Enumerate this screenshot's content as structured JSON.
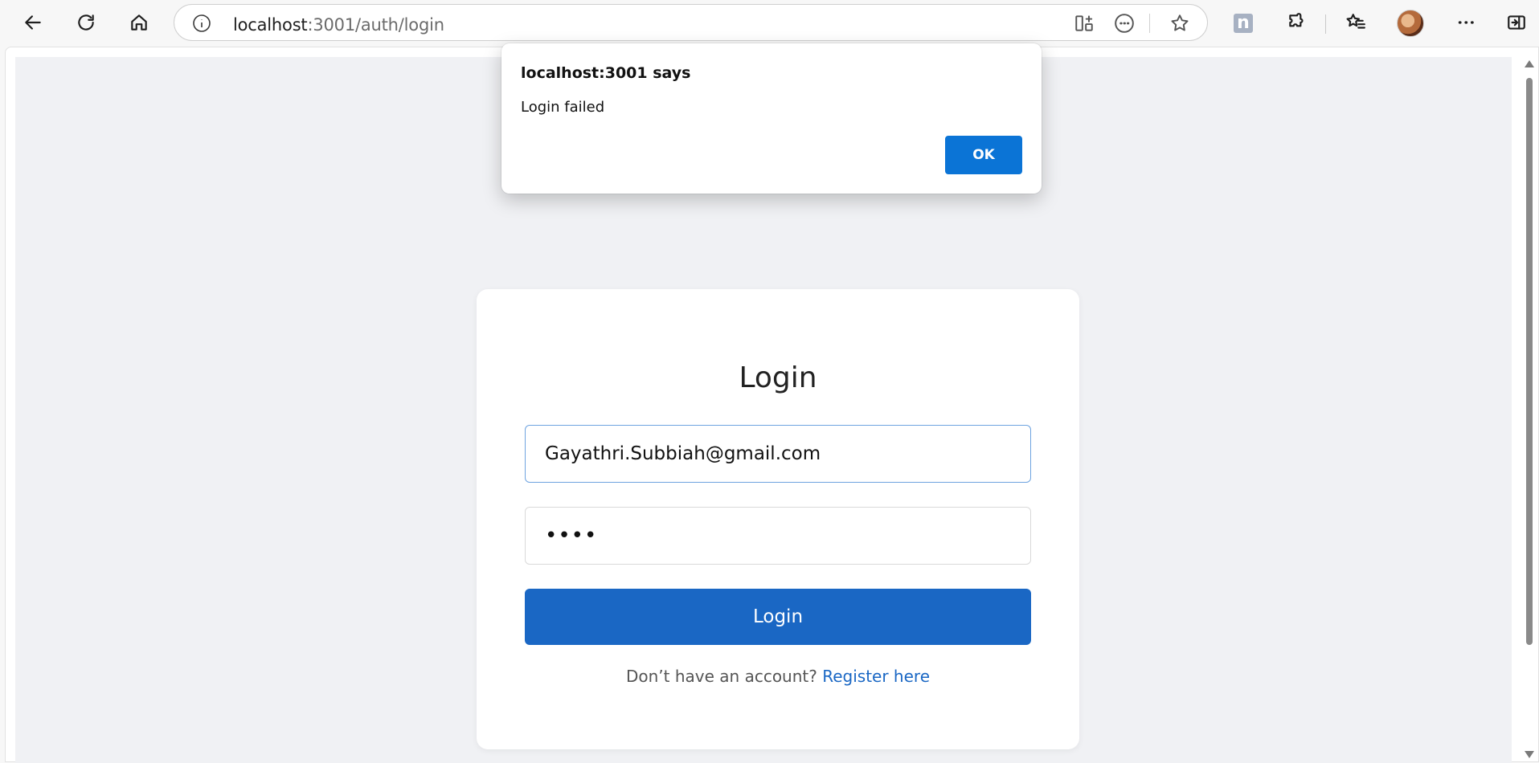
{
  "browser": {
    "url_host": "localhost",
    "url_path": ":3001/auth/login",
    "extension_label": "n",
    "icons": {
      "back": "back-arrow-icon",
      "reload": "reload-icon",
      "home": "home-icon",
      "site_info": "info-icon",
      "split_screen": "split-screen-icon",
      "more_page": "ellipsis-circle-icon",
      "favorite": "star-icon",
      "extensions": "puzzle-icon",
      "favorites": "favorites-list-icon",
      "menu": "more-icon",
      "sidebar": "sidebar-icon"
    }
  },
  "dialog": {
    "title": "localhost:3001 says",
    "message": "Login failed",
    "ok_label": "OK"
  },
  "login": {
    "heading": "Login",
    "email_value": "Gayathri.Subbiah@gmail.com",
    "password_mask": "••••",
    "submit_label": "Login",
    "register_prompt": "Don’t have an account?",
    "register_link": "Register here"
  },
  "colors": {
    "primary": "#1a67c4",
    "dialog_ok": "#0b74d6",
    "page_bg": "#f0f1f4"
  }
}
